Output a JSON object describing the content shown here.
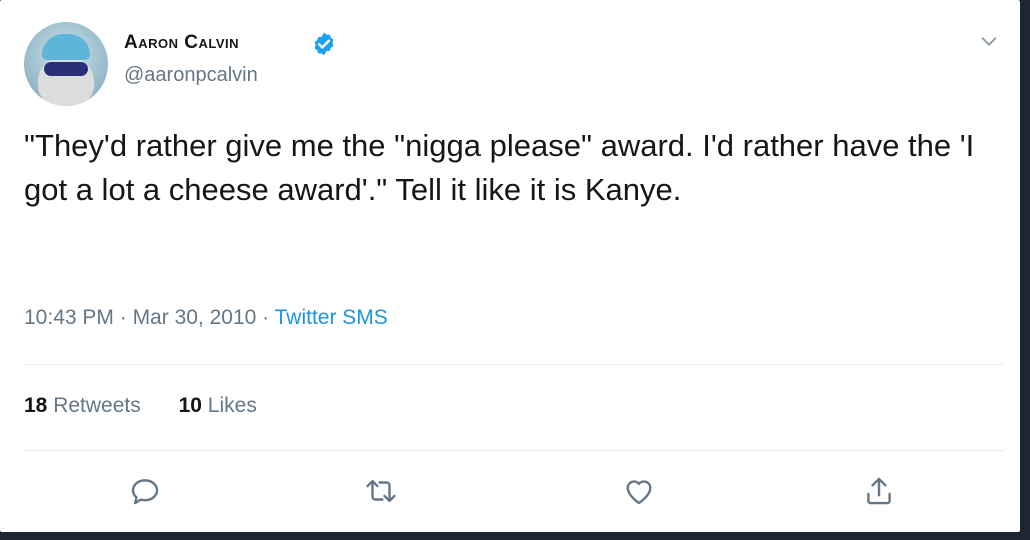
{
  "author": {
    "name": "Aaron Calvin",
    "handle": "@aaronpcalvin",
    "verified": true
  },
  "tweet": {
    "text": "\"They'd rather give me the \"nigga please\" award. I'd rather have the 'I got a lot a cheese award'.\" Tell it like it is Kanye.",
    "time": "10:43 PM",
    "date": "Mar 30, 2010",
    "source": "Twitter SMS"
  },
  "stats": {
    "retweets_count": "18",
    "retweets_label": "Retweets",
    "likes_count": "10",
    "likes_label": "Likes"
  },
  "icons": {
    "reply": "reply-icon",
    "retweet": "retweet-icon",
    "like": "heart-icon",
    "share": "share-icon",
    "menu": "chevron-down-icon",
    "verified": "verified-badge-icon"
  },
  "colors": {
    "text": "#14171a",
    "secondary": "#657786",
    "link": "#1b95e0",
    "verified": "#1da1f2",
    "background": "#1c2733"
  }
}
